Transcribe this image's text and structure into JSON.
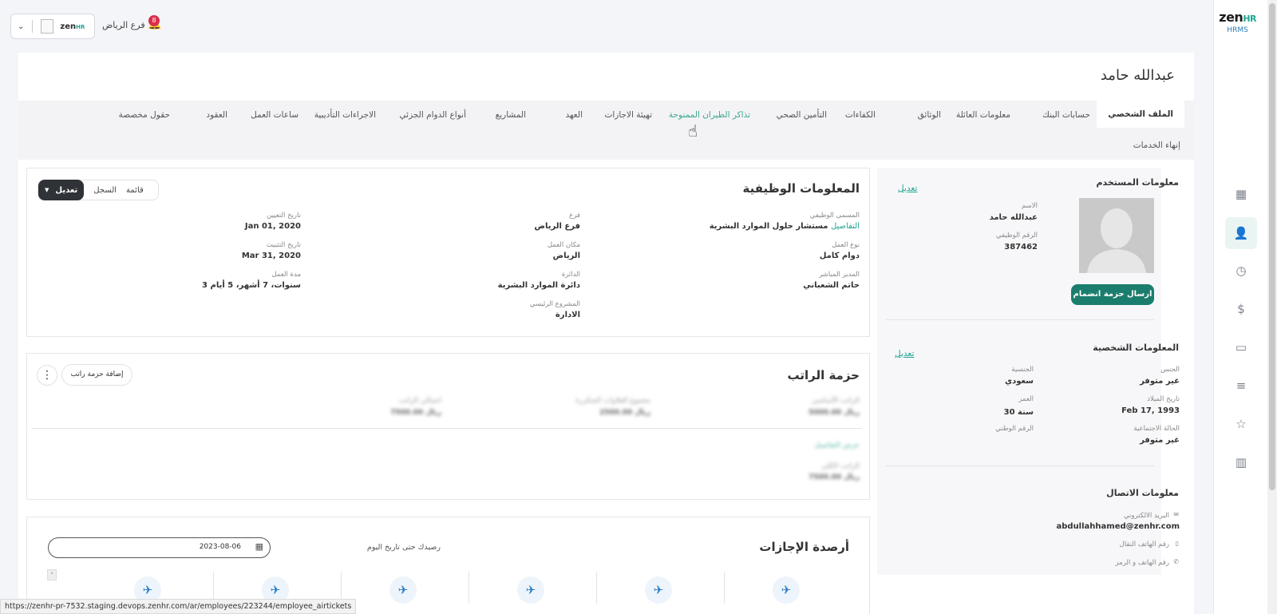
{
  "brand": {
    "logo_main": "zen",
    "logo_hr": "HR",
    "logo_sub": "HRMS"
  },
  "topbar": {
    "branch": "فرع الرياض",
    "notif_count": "8"
  },
  "rail_icons": [
    "grid-icon",
    "users-icon",
    "clock-icon",
    "dollar-icon",
    "folder-icon",
    "list-icon",
    "star-icon",
    "chart-icon"
  ],
  "employee": {
    "name": "عبدالله حامد"
  },
  "tabs": [
    "الملف الشخصي",
    "حسابات البنك",
    "معلومات العائلة",
    "الوثائق",
    "الكفاءات",
    "التأمين الصحي",
    "تذاكر الطيران الممنوحة",
    "تهيئة الاجازات",
    "العهد",
    "المشاريع",
    "أنواع الدوام الجزئي",
    "الاجراءات التأديبية",
    "ساعات العمل",
    "العقود",
    "حقول مخصصة",
    "إنهاء الخدمات"
  ],
  "user_info": {
    "title": "معلومات المستخدم",
    "edit": "تعديل",
    "name_label": "الاسم",
    "name": "عبدالله حامد",
    "job_no_label": "الرقم الوظيفي",
    "job_no": "387462",
    "onboarding_button": "ارسال حزمة انضمام"
  },
  "personal_info": {
    "title": "المعلومات الشخصية",
    "edit": "تعديل",
    "gender_label": "الجنس",
    "gender": "غير متوفر",
    "nationality_label": "الجنسية",
    "nationality": "سعودي",
    "dob_label": "تاريخ الميلاد",
    "dob": "Feb 17, 1993",
    "age_label": "العمر",
    "age": "30 سنة",
    "marital_label": "الحالة الاجتماعية",
    "marital": "غير متوفر",
    "national_id_label": "الرقم الوطني"
  },
  "contact_info": {
    "title": "معلومات الاتصال",
    "email_label": "البريد الالكتروني",
    "email": "abdullahhamed@zenhr.com",
    "mobile_label": "رقم الهاتف النقال",
    "phone_label": "رقم الهاتف و الرمز"
  },
  "job_info": {
    "title": "المعلومات الوظيفية",
    "view_list": "قائمة",
    "view_log": "السجل",
    "edit": "تعديل",
    "job_title_label": "المسمى الوظيفي",
    "job_title": "مستشار حلول الموارد البشرية",
    "details_link": "التفاصيل",
    "branch_label": "فرع",
    "branch": "فرع الرياض",
    "hire_date_label": "تاريخ التعيين",
    "hire_date": "Jan 01, 2020",
    "work_type_label": "نوع العمل",
    "work_type": "دوام كامل",
    "work_place_label": "مكان العمل",
    "work_place": "الرياض",
    "confirm_date_label": "تاريخ التثبيت",
    "confirm_date": "Mar 31, 2020",
    "manager_label": "المدير المباشر",
    "manager": "حاتم الشعباني",
    "department_label": "الدائرة",
    "department": "دائرة الموارد البشرية",
    "service_label": "مدة العمل",
    "service": "3 سنوات، 7 أشهر، 5 أيام",
    "main_project_label": "المشروع الرئيسي",
    "main_project": "الادارة"
  },
  "salary": {
    "title": "حزمة الراتب",
    "add_button": "إضافة حزمة راتب",
    "blur_l1": "الراتب الأساسي",
    "blur_v1": "5000.00",
    "blur_l2": "مجموع العلاوات المتكررة",
    "blur_v2": "2500.00",
    "blur_l3": "اجمالي الراتب",
    "blur_v3": "7500.00",
    "blur_link": "عرض التفاصيل",
    "blur_l4": "الراتب الكلي",
    "blur_v4": "7500.00",
    "currency": "ريال"
  },
  "leave": {
    "title": "أرصدة الإجازات",
    "balance_note": "رصيدك حتى تاريخ اليوم",
    "date": "2023-08-06",
    "types": 6
  },
  "statusbar": {
    "url": "https://zenhr-pr-7532.staging.devops.zenhr.com/ar/employees/223244/employee_airtickets"
  }
}
